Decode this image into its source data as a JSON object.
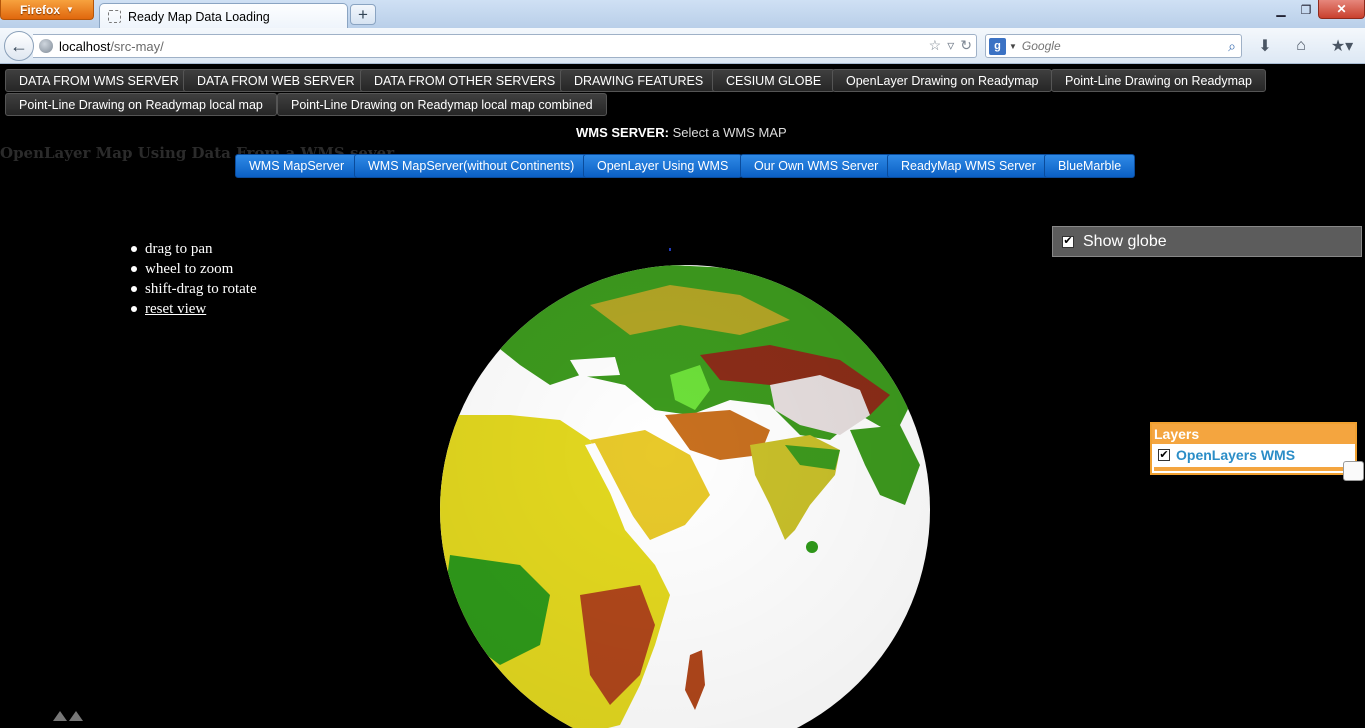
{
  "browser": {
    "menu_label": "Firefox",
    "tab_title": "Ready Map Data Loading",
    "new_tab_symbol": "+",
    "window_controls": [
      "minimize-icon",
      "maximize-icon",
      "close-icon"
    ],
    "url_host": "localhost",
    "url_path": "/src-may/",
    "search_engine_icon": "google-icon",
    "search_placeholder": "Google"
  },
  "top_nav": [
    "DATA FROM WMS SERVER",
    "DATA FROM WEB SERVER",
    "DATA FROM OTHER SERVERS",
    "DRAWING FEATURES",
    "CESIUM GLOBE",
    "OpenLayer Drawing on Readymap",
    "Point-Line Drawing on Readymap",
    "Point-Line Drawing on Readymap local map",
    "Point-Line Drawing on Readymap local map combined"
  ],
  "wms": {
    "label_bold": "WMS SERVER:",
    "label_rest": "Select a WMS MAP",
    "buttons": [
      "WMS MapServer",
      "WMS MapServer(without Continents)",
      "OpenLayer Using WMS",
      "Our Own WMS Server",
      "ReadyMap WMS Server",
      "BlueMarble"
    ],
    "button_color": "#1670d8"
  },
  "page_title": "OpenLayer Map Using Data From a WMS sever",
  "help": {
    "items": [
      "drag to pan",
      "wheel to zoom",
      "shift-drag to rotate"
    ],
    "reset_link": "reset view"
  },
  "show_globe": {
    "label": "Show globe",
    "checked": true
  },
  "layers": {
    "header": "Layers",
    "items": [
      {
        "label": "OpenLayers WMS",
        "checked": true
      }
    ],
    "accent": "#f4a53f"
  },
  "globe": {
    "icon": "earth-globe",
    "land_colors": [
      "#2f9a1a",
      "#e8e02a",
      "#c0501c",
      "#8b2d18",
      "#ffffff"
    ],
    "water_color": "#ffffff"
  }
}
